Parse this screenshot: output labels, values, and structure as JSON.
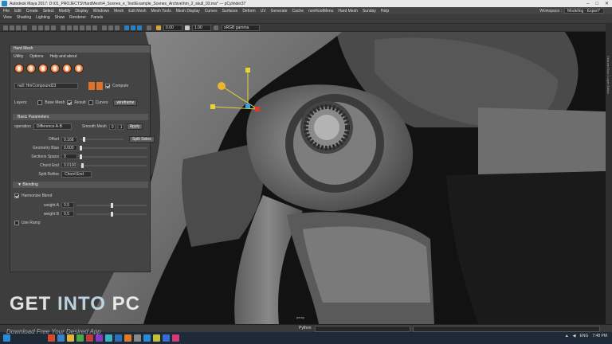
{
  "window": {
    "title": "Autodesk Maya 2017: D:\\01_PROJECTS\\HardMesh\\4_Scenes_e_Test\\Example_Scenes_Archive\\hm_2_skull_03.ma* --- pCylinder37",
    "controls": [
      "–",
      "□",
      "✕"
    ]
  },
  "menubar": {
    "items": [
      "File",
      "Edit",
      "Create",
      "Select",
      "Modify",
      "Display",
      "Windows",
      "Mesh",
      "Edit Mesh",
      "Mesh Tools",
      "Mesh Display",
      "Curves",
      "Surfaces",
      "Deform",
      "UV",
      "Generate",
      "Cache",
      "nonRootMenu",
      "Hard Mesh",
      "Sunday",
      "Help"
    ],
    "workspace_label": "Workspace :",
    "workspace_value": "Modeling - Expert*"
  },
  "viewport_menu": [
    "View",
    "Shading",
    "Lighting",
    "Show",
    "Renderer",
    "Panels"
  ],
  "viewport_toolbar": {
    "field1": "0.00",
    "field2": "1.00",
    "colorspace": "sRGB gamma",
    "camera_label": "persp"
  },
  "right_strip_label": "Channel Box / Layer Editor",
  "hardmesh": {
    "title": "Hard Mesh",
    "menu": [
      "Utility",
      "Options",
      "Help and about"
    ],
    "compound_value": "null: HmCompound23",
    "mini_icons": [
      "Menu",
      "Edit"
    ],
    "compute_label": "Compute",
    "layers_label": "Layers:",
    "base_mesh_label": "Base Mesh",
    "result_label": "Result",
    "curves_label": "Curves",
    "wireframe_button": "wireframe",
    "basic_params_header": "Basic Parameters",
    "operation_label": "operation",
    "operation_value": "Difference A-B",
    "smooth_mesh_label": "Smooth Mesh",
    "smooth_mesh_a": "0",
    "smooth_mesh_b": "1",
    "apply_button": "Apply",
    "offset_label": "Offset",
    "offset_value": "0.166",
    "offset_level": 0.08,
    "split_sides_button": "Split Sides",
    "geometry_bias_label": "Geometry Bias",
    "geometry_bias_value": "0.000",
    "geometry_bias_level": 0.0,
    "sections_label": "Sections Spans",
    "sections_value": "0",
    "sections_level": 0.0,
    "chord_end_label": "Chord End",
    "chord_end_value": "0.0100",
    "chord_end_level": 0.02,
    "split_refine_label": "Split Refine",
    "split_refine_value": "Chord End",
    "blending_header": "Blending",
    "harmonize_label": "Harmonize Blend",
    "weight_a_label": "weight A",
    "weight_a_value": "0.5",
    "weight_a_level": 0.5,
    "weight_b_label": "weight B",
    "weight_b_value": "0.5",
    "weight_b_level": 0.5,
    "use_ramp_label": "Use Ramp"
  },
  "cmdline": {
    "label": "Python"
  },
  "taskbar": {
    "time": "7:48 PM",
    "lang": "ENG"
  },
  "watermark": {
    "get": "GET",
    "into": "INTO",
    "pc": "PC",
    "sub": "Download Free Your Desired App"
  }
}
